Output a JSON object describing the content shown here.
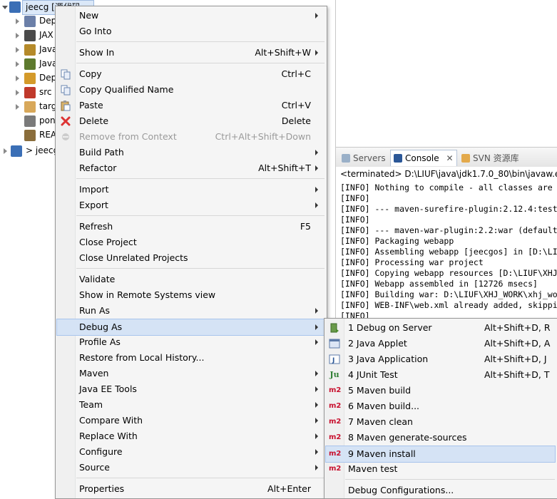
{
  "tree": {
    "root_label": "jeecg [源代码.~",
    "items": [
      {
        "label": "Dep",
        "icon": "dependencies-icon",
        "color": "#6b7fa8"
      },
      {
        "label": "JAX",
        "icon": "jax-ws-icon",
        "color": "#4a4a4a"
      },
      {
        "label": "Java",
        "icon": "java-resources-icon",
        "color": "#b58a2a"
      },
      {
        "label": "Java",
        "icon": "java-library-icon",
        "color": "#5d7a2e"
      },
      {
        "label": "Dep",
        "icon": "deployed-resources-icon",
        "color": "#d49a2a"
      },
      {
        "label": "src",
        "icon": "src-folder-icon",
        "color": "#c0392b"
      },
      {
        "label": "targ",
        "icon": "target-folder-icon",
        "color": "#d8a85a"
      },
      {
        "label": "pon",
        "icon": "pom-file-icon",
        "color": "#7a7a7a"
      },
      {
        "label": "REA",
        "icon": "readme-file-icon",
        "color": "#8a6d3b"
      }
    ],
    "sibling_label": "> jeecg"
  },
  "console_view": {
    "tabs": [
      {
        "label": "Servers",
        "icon": "servers-icon",
        "active": false
      },
      {
        "label": "Console",
        "icon": "console-icon",
        "active": true
      },
      {
        "label": "SVN 资源库",
        "icon": "svn-icon",
        "active": false
      }
    ],
    "status": "<terminated> D:\\LIUF\\java\\jdk1.7.0_80\\bin\\javaw.exe",
    "lines": [
      "[INFO] Nothing to compile - all classes are",
      "[INFO]",
      "[INFO] --- maven-surefire-plugin:2.12.4:test",
      "[INFO]",
      "[INFO] --- maven-war-plugin:2.2:war (default",
      "[INFO] Packaging webapp",
      "[INFO] Assembling webapp [jeecgos] in [D:\\LI",
      "[INFO] Processing war project",
      "[INFO] Copying webapp resources [D:\\LIUF\\XHJ",
      "[INFO] Webapp assembled in [12726 msecs]",
      "[INFO] Building war: D:\\LIUF\\XHJ_WORK\\xhj_wo",
      "[INFO] WEB-INF\\web.xml already added, skippi",
      "[INFO]"
    ]
  },
  "context_menu": {
    "items": [
      {
        "label": "New",
        "shortcut": "",
        "submenu": true,
        "icon": ""
      },
      {
        "label": "Go Into",
        "shortcut": "",
        "submenu": false,
        "icon": ""
      },
      {
        "sep": true
      },
      {
        "label": "Show In",
        "shortcut": "Alt+Shift+W",
        "submenu": true,
        "icon": ""
      },
      {
        "sep": true
      },
      {
        "label": "Copy",
        "shortcut": "Ctrl+C",
        "submenu": false,
        "icon": "copy-icon"
      },
      {
        "label": "Copy Qualified Name",
        "shortcut": "",
        "submenu": false,
        "icon": "copy-qualified-name-icon"
      },
      {
        "label": "Paste",
        "shortcut": "Ctrl+V",
        "submenu": false,
        "icon": "paste-icon"
      },
      {
        "label": "Delete",
        "shortcut": "Delete",
        "submenu": false,
        "icon": "delete-icon"
      },
      {
        "label": "Remove from Context",
        "shortcut": "Ctrl+Alt+Shift+Down",
        "submenu": false,
        "icon": "remove-context-icon",
        "disabled": true
      },
      {
        "label": "Build Path",
        "shortcut": "",
        "submenu": true,
        "icon": ""
      },
      {
        "label": "Refactor",
        "shortcut": "Alt+Shift+T",
        "submenu": true,
        "icon": ""
      },
      {
        "sep": true
      },
      {
        "label": "Import",
        "shortcut": "",
        "submenu": true,
        "icon": ""
      },
      {
        "label": "Export",
        "shortcut": "",
        "submenu": true,
        "icon": ""
      },
      {
        "sep": true
      },
      {
        "label": "Refresh",
        "shortcut": "F5",
        "submenu": false,
        "icon": ""
      },
      {
        "label": "Close Project",
        "shortcut": "",
        "submenu": false,
        "icon": ""
      },
      {
        "label": "Close Unrelated Projects",
        "shortcut": "",
        "submenu": false,
        "icon": ""
      },
      {
        "sep": true
      },
      {
        "label": "Validate",
        "shortcut": "",
        "submenu": false,
        "icon": ""
      },
      {
        "label": "Show in Remote Systems view",
        "shortcut": "",
        "submenu": false,
        "icon": ""
      },
      {
        "label": "Run As",
        "shortcut": "",
        "submenu": true,
        "icon": ""
      },
      {
        "label": "Debug As",
        "shortcut": "",
        "submenu": true,
        "icon": "",
        "highlight": true
      },
      {
        "label": "Profile As",
        "shortcut": "",
        "submenu": true,
        "icon": ""
      },
      {
        "label": "Restore from Local History...",
        "shortcut": "",
        "submenu": false,
        "icon": ""
      },
      {
        "label": "Maven",
        "shortcut": "",
        "submenu": true,
        "icon": ""
      },
      {
        "label": "Java EE Tools",
        "shortcut": "",
        "submenu": true,
        "icon": ""
      },
      {
        "label": "Team",
        "shortcut": "",
        "submenu": true,
        "icon": ""
      },
      {
        "label": "Compare With",
        "shortcut": "",
        "submenu": true,
        "icon": ""
      },
      {
        "label": "Replace With",
        "shortcut": "",
        "submenu": true,
        "icon": ""
      },
      {
        "label": "Configure",
        "shortcut": "",
        "submenu": true,
        "icon": ""
      },
      {
        "label": "Source",
        "shortcut": "",
        "submenu": true,
        "icon": ""
      },
      {
        "sep": true
      },
      {
        "label": "Properties",
        "shortcut": "Alt+Enter",
        "submenu": false,
        "icon": ""
      }
    ]
  },
  "debug_submenu": {
    "items": [
      {
        "label": "1 Debug on Server",
        "shortcut": "Alt+Shift+D, R",
        "icon": "debug-server-icon"
      },
      {
        "label": "2 Java Applet",
        "shortcut": "Alt+Shift+D, A",
        "icon": "java-applet-icon"
      },
      {
        "label": "3 Java Application",
        "shortcut": "Alt+Shift+D, J",
        "icon": "java-application-icon"
      },
      {
        "label": "4 JUnit Test",
        "shortcut": "Alt+Shift+D, T",
        "icon": "junit-icon",
        "icon_text": "Ju"
      },
      {
        "label": "5 Maven build",
        "shortcut": "",
        "icon": "maven-icon",
        "icon_text": "m2"
      },
      {
        "label": "6 Maven build...",
        "shortcut": "",
        "icon": "maven-icon",
        "icon_text": "m2"
      },
      {
        "label": "7 Maven clean",
        "shortcut": "",
        "icon": "maven-icon",
        "icon_text": "m2"
      },
      {
        "label": "8 Maven generate-sources",
        "shortcut": "",
        "icon": "maven-icon",
        "icon_text": "m2"
      },
      {
        "label": "9 Maven install",
        "shortcut": "",
        "icon": "maven-icon",
        "icon_text": "m2",
        "highlight": true
      },
      {
        "label": "Maven test",
        "shortcut": "",
        "icon": "maven-icon",
        "icon_text": "m2"
      },
      {
        "sep": true
      },
      {
        "label": "Debug Configurations...",
        "shortcut": "",
        "icon": ""
      }
    ]
  }
}
